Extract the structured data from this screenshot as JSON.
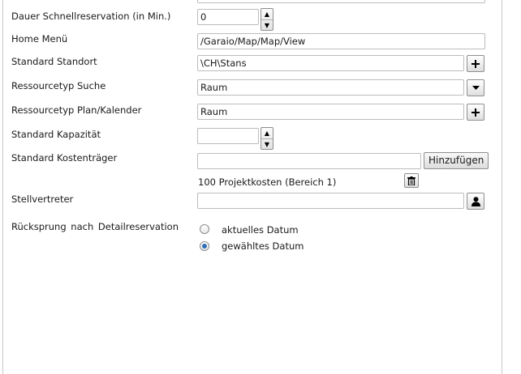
{
  "form": {
    "quick_reservation": {
      "label": "Dauer Schnellreservation (in Min.)",
      "value": "0"
    },
    "home_menu": {
      "label": "Home Menü",
      "value": "/Garaio/Map/Map/View"
    },
    "default_location": {
      "label": "Standard Standort",
      "value": "\\CH\\Stans"
    },
    "resource_type_search": {
      "label": "Ressourcetyp Suche",
      "value": "Raum"
    },
    "resource_type_plan": {
      "label": "Ressourcetyp Plan/Kalender",
      "value": "Raum"
    },
    "default_capacity": {
      "label": "Standard Kapazität",
      "value": ""
    },
    "default_cost_center": {
      "label": "Standard Kostenträger",
      "value": "",
      "add_button": "Hinzufügen",
      "entries": [
        "100 Projektkosten (Bereich 1)"
      ]
    },
    "deputy": {
      "label": "Stellvertreter",
      "value": ""
    },
    "return_after_detail": {
      "label": "Rücksprung nach Detailreservation",
      "options": [
        {
          "label": "aktuelles Datum",
          "checked": false
        },
        {
          "label": "gewähltes Datum",
          "checked": true
        }
      ]
    }
  },
  "icons": {
    "spinner": "spinner-up-down",
    "add": "plus-icon",
    "dropdown": "chevron-down-icon",
    "delete": "trash-icon",
    "user": "user-icon"
  }
}
